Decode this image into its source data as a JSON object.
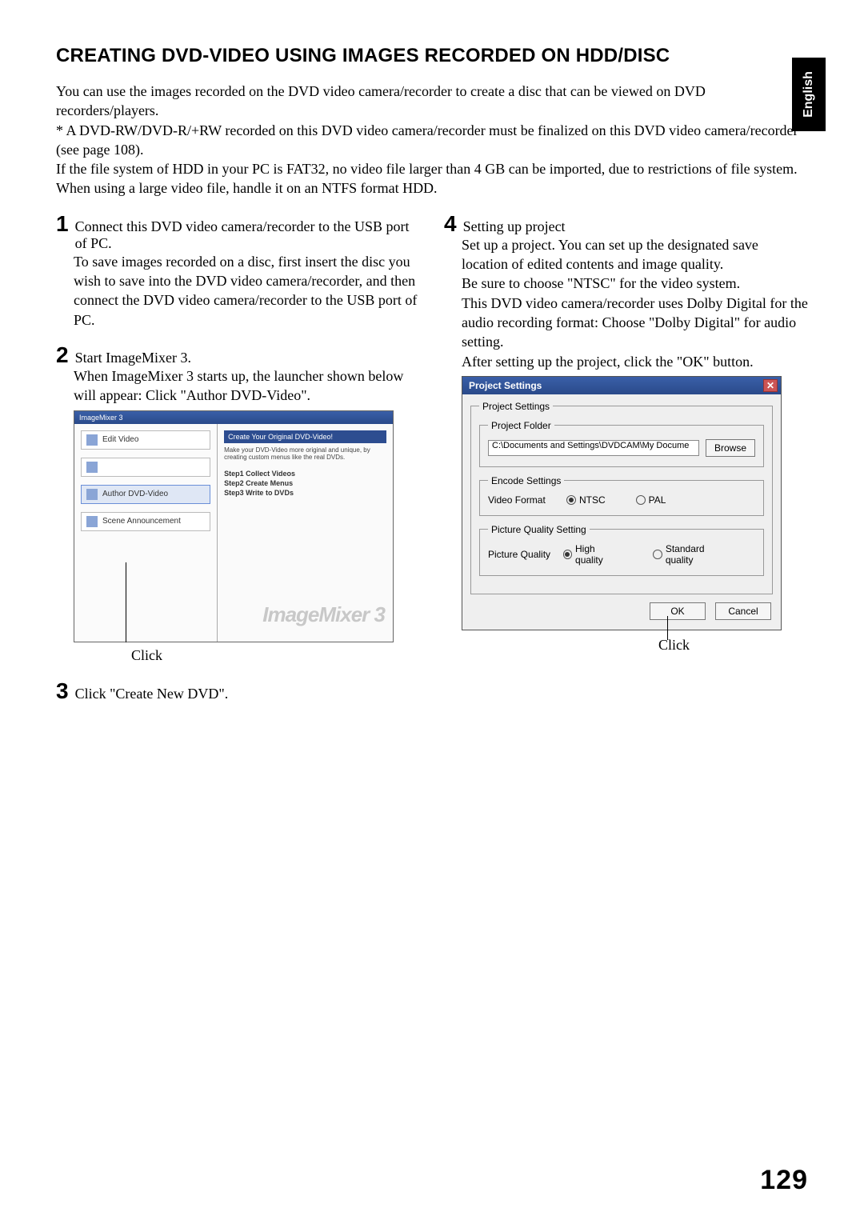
{
  "language_tab": "English",
  "title": "CREATING DVD-VIDEO USING IMAGES RECORDED ON HDD/DISC",
  "intro": {
    "p1": "You can use the images recorded on the DVD video camera/recorder to create a disc that can be viewed on DVD recorders/players.",
    "p2": "* A DVD-RW/DVD-R/+RW recorded on this DVD video camera/recorder must be finalized on this DVD video camera/recorder (see page 108).",
    "p3": "If the file system of HDD in your PC is FAT32, no video file larger than 4 GB can be imported, due to restrictions of file system.",
    "p4": "When using a large video file, handle it on an NTFS format HDD."
  },
  "steps": {
    "s1": {
      "num": "1",
      "title": "Connect this DVD video camera/recorder to the USB port of PC.",
      "body": "To save images recorded on a disc, first insert the disc you wish to save into the DVD video camera/recorder, and then connect the DVD video camera/recorder to the USB port of PC."
    },
    "s2": {
      "num": "2",
      "title": "Start ImageMixer 3.",
      "body": "When ImageMixer 3 starts up, the launcher shown below will appear: Click \"Author DVD-Video\"."
    },
    "s3": {
      "num": "3",
      "title": "Click \"Create New DVD\"."
    },
    "s4": {
      "num": "4",
      "title": "Setting up project",
      "body1": "Set up a project. You can set up the designated save location of edited contents and image quality.",
      "body2": "Be sure to choose \"NTSC\" for the video system.",
      "body3": "This DVD video camera/recorder uses Dolby Digital for the audio recording format: Choose \"Dolby Digital\" for audio setting.",
      "body4": "After setting up the project, click the \"OK\" button."
    }
  },
  "launcher": {
    "window_title": "ImageMixer 3",
    "sidebar": {
      "edit": "Edit Video",
      "unnamed": "",
      "author": "Author DVD-Video",
      "announce": "Scene Announcement"
    },
    "main": {
      "head": "Create Your Original DVD-Video!",
      "sub": "Make your DVD-Video more original and unique, by creating custom menus like the real DVDs.",
      "step1": "Step1 Collect Videos",
      "step2": "Step2 Create Menus",
      "step3": "Step3 Write to DVDs"
    },
    "watermark": "ImageMixer 3"
  },
  "click_label": "Click",
  "dialog": {
    "title": "Project Settings",
    "fs_outer": "Project Settings",
    "fs_folder": "Project Folder",
    "folder_value": "C:\\Documents and Settings\\DVDCAM\\My Docume",
    "browse": "Browse",
    "fs_encode": "Encode Settings",
    "video_format_label": "Video Format",
    "ntsc": "NTSC",
    "pal": "PAL",
    "fs_quality": "Picture Quality Setting",
    "picture_quality_label": "Picture Quality",
    "high": "High quality",
    "standard": "Standard quality",
    "ok": "OK",
    "cancel": "Cancel"
  },
  "page_number": "129"
}
